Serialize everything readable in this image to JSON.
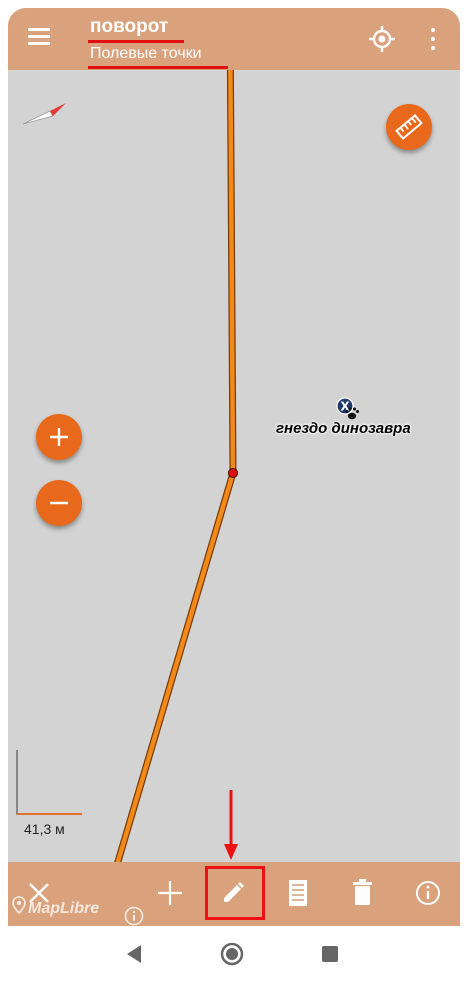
{
  "header": {
    "title": "поворот",
    "subtitle": "Полевые точки",
    "menu_icon": "hamburger-menu-icon",
    "location_icon": "gps-locate-icon",
    "overflow_icon": "more-vert-icon"
  },
  "map": {
    "poi": {
      "label": "гнездо динозавра",
      "icon": "paw-print-icon"
    },
    "scale_label": "41,3 м",
    "attribution": "MapLibre",
    "compass_icon": "compass-needle-icon",
    "ruler_icon": "ruler-icon",
    "zoom_in_icon": "plus-icon",
    "zoom_out_icon": "minus-icon"
  },
  "toolbar": {
    "items": [
      {
        "name": "close",
        "icon": "close-icon"
      },
      {
        "name": "add",
        "icon": "plus-icon"
      },
      {
        "name": "edit",
        "icon": "pencil-icon",
        "highlighted": true
      },
      {
        "name": "notes",
        "icon": "document-icon"
      },
      {
        "name": "delete",
        "icon": "trash-icon"
      },
      {
        "name": "info",
        "icon": "info-icon"
      }
    ]
  },
  "colors": {
    "bar": "#d9a27c",
    "accent": "#e8691b",
    "route": "#f28a1b",
    "highlight": "#ee1111",
    "map_bg": "#d3d3d3"
  },
  "system_nav": [
    "back-icon",
    "home-icon",
    "recents-icon"
  ]
}
